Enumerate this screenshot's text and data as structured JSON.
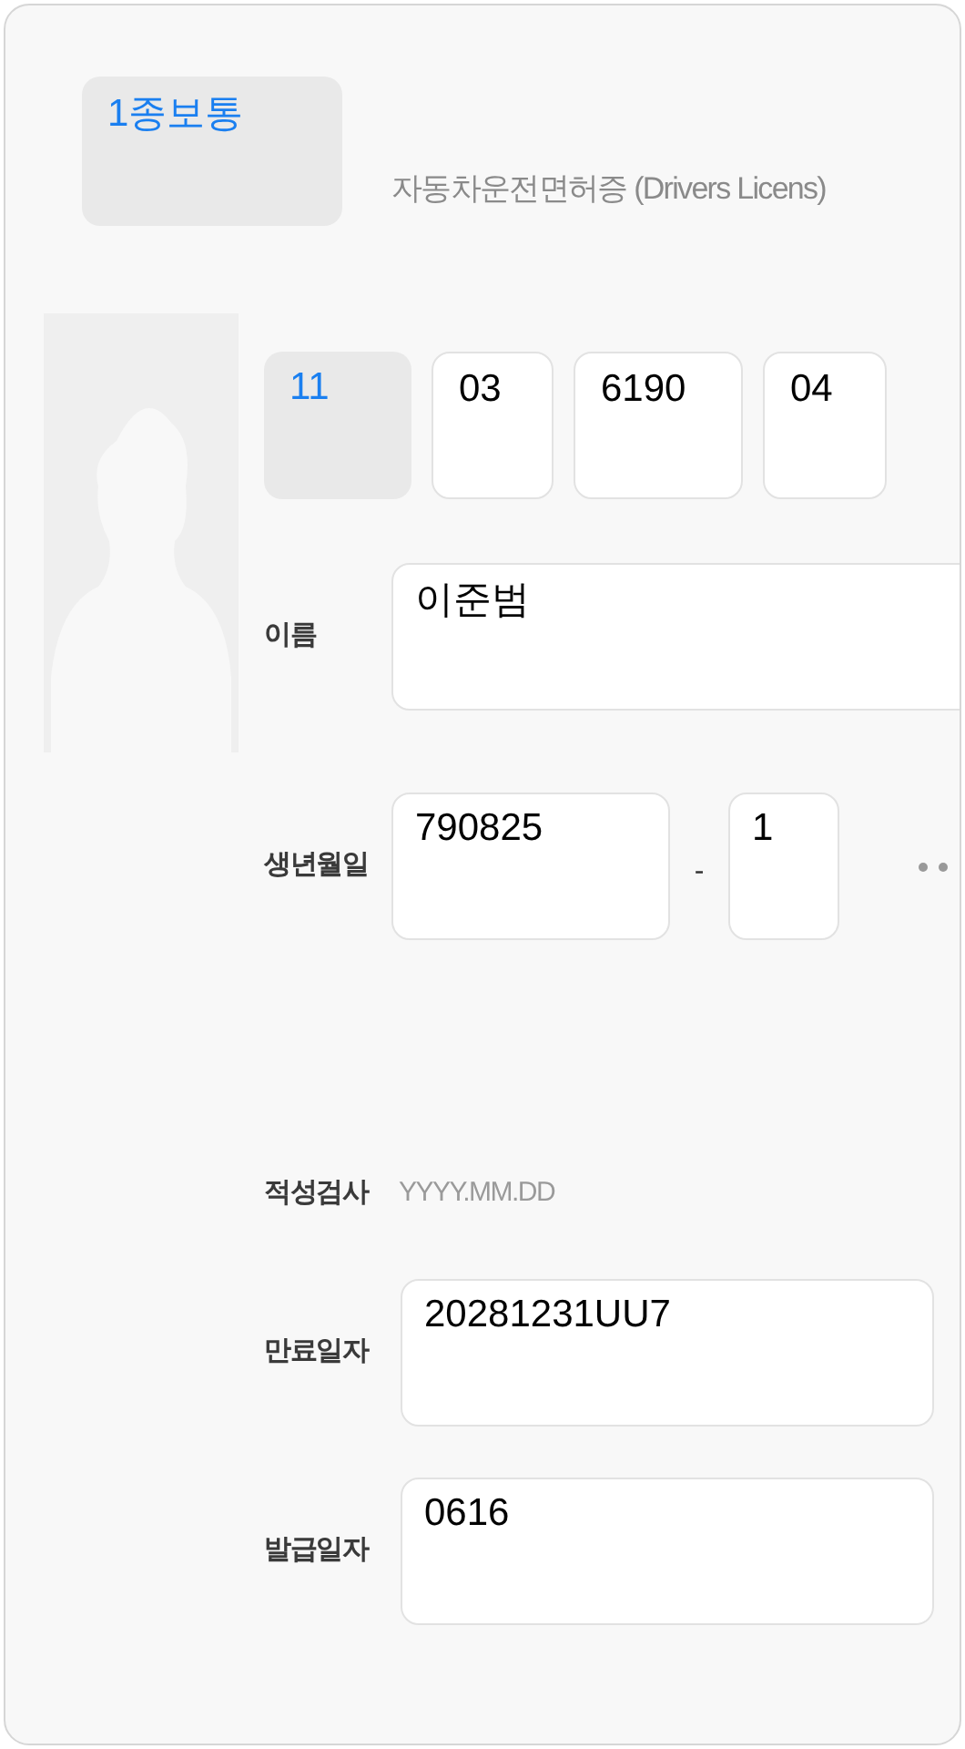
{
  "license_type": {
    "value": "1종보통",
    "disabled": true
  },
  "title": "자동차운전면허증 (Drivers Licens)",
  "license_number": [
    {
      "value": "11",
      "disabled": true
    },
    {
      "value": "03",
      "disabled": false
    },
    {
      "value": "6190",
      "disabled": false
    },
    {
      "value": "04",
      "disabled": false
    }
  ],
  "fields": [
    {
      "label": "이름",
      "kind": "name",
      "value": "이준범"
    },
    {
      "label": "생년월일",
      "kind": "birth",
      "value": "790825",
      "separator": "-",
      "suffix": "1"
    },
    {
      "label": "적성검사",
      "kind": "plain",
      "placeholder": "YYYY.MM.DD"
    },
    {
      "label": "만료일자",
      "kind": "box",
      "value": "20281231UU7"
    },
    {
      "label": "발급일자",
      "kind": "box",
      "value": "0616"
    }
  ]
}
